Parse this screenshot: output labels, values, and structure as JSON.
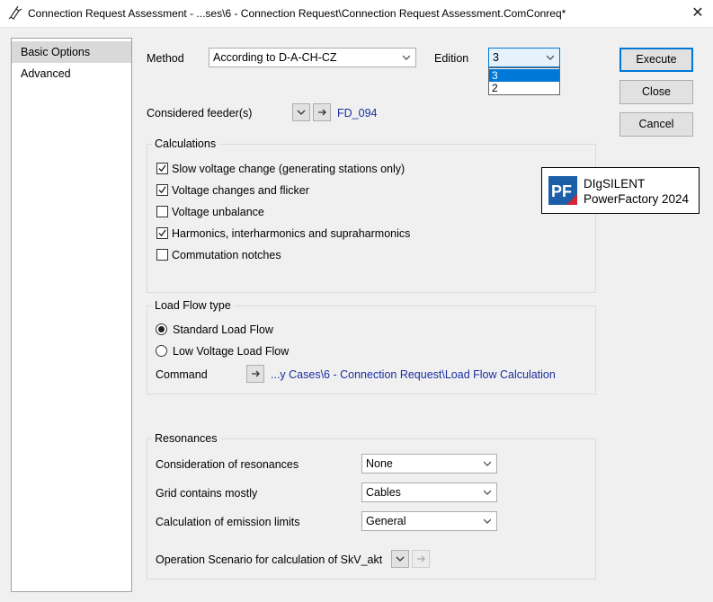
{
  "window": {
    "title": "Connection Request Assessment - ...ses\\6 - Connection Request\\Connection Request Assessment.ComConreq*"
  },
  "nav": {
    "items": [
      {
        "label": "Basic Options",
        "selected": true
      },
      {
        "label": "Advanced",
        "selected": false
      }
    ]
  },
  "method": {
    "label": "Method",
    "value": "According to D-A-CH-CZ"
  },
  "edition": {
    "label": "Edition",
    "value": "3",
    "options": [
      "3",
      "2"
    ],
    "selected_option": "3"
  },
  "feeder": {
    "label": "Considered feeder(s)",
    "value": "FD_094"
  },
  "calculations": {
    "title": "Calculations",
    "items": [
      {
        "label": "Slow voltage change (generating stations only)",
        "checked": true
      },
      {
        "label": "Voltage changes and flicker",
        "checked": true
      },
      {
        "label": "Voltage unbalance",
        "checked": false
      },
      {
        "label": "Harmonics, interharmonics and supraharmonics",
        "checked": true
      },
      {
        "label": "Commutation notches",
        "checked": false
      }
    ]
  },
  "loadflow": {
    "title": "Load Flow type",
    "options": [
      {
        "label": "Standard Load Flow",
        "selected": true
      },
      {
        "label": "Low Voltage Load Flow",
        "selected": false
      }
    ],
    "command_label": "Command",
    "command_value": "...y Cases\\6 - Connection Request\\Load Flow Calculation"
  },
  "resonances": {
    "title": "Resonances",
    "consideration": {
      "label": "Consideration of resonances",
      "value": "None"
    },
    "grid": {
      "label": "Grid contains mostly",
      "value": "Cables"
    },
    "emission": {
      "label": "Calculation of emission limits",
      "value": "General"
    },
    "scenario": {
      "label": "Operation Scenario for calculation of SkV_akt"
    }
  },
  "buttons": {
    "execute": "Execute",
    "close": "Close",
    "cancel": "Cancel"
  },
  "logo": {
    "mark": "PF",
    "line1": "DIgSILENT",
    "line2": "PowerFactory 2024"
  },
  "icons": {
    "app": "pencil-plug-icon",
    "close": "close-x-icon",
    "chevron": "chevron-down-icon",
    "arrow": "arrow-right-icon",
    "check": "check-icon"
  },
  "colors": {
    "accent": "#0078d7",
    "link": "#1a2ea0",
    "logo_blue": "#1c5ea8",
    "logo_red": "#d22630"
  }
}
